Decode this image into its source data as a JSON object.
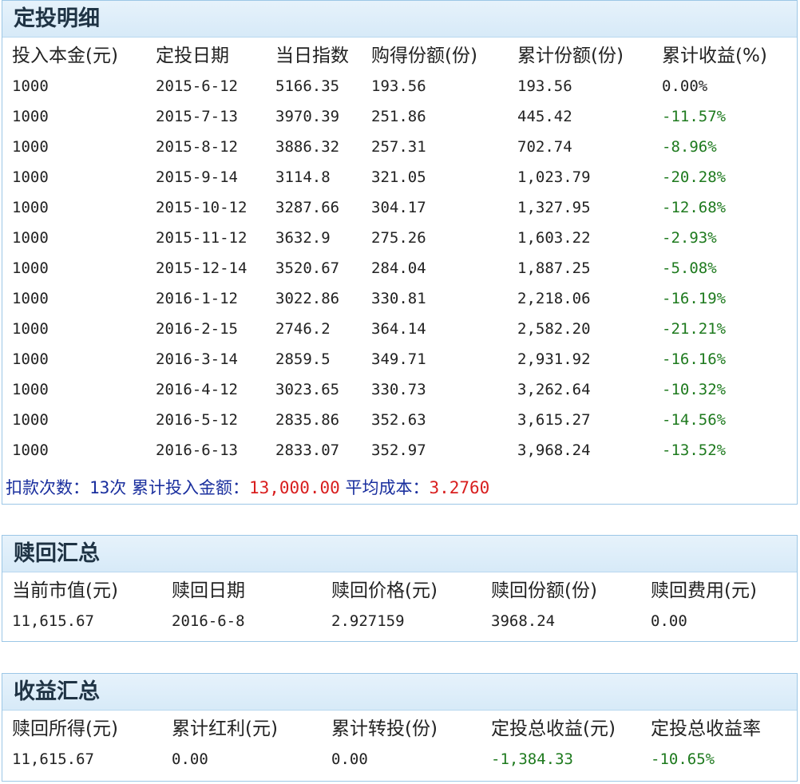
{
  "detail": {
    "title": "定投明细",
    "headers": [
      "投入本金(元)",
      "定投日期",
      "当日指数",
      "购得份额(份)",
      "累计份额(份)",
      "累计收益(%)"
    ],
    "rows": [
      [
        "1000",
        "2015-6-12",
        "5166.35",
        "193.56",
        "193.56",
        "0.00%"
      ],
      [
        "1000",
        "2015-7-13",
        "3970.39",
        "251.86",
        "445.42",
        "-11.57%"
      ],
      [
        "1000",
        "2015-8-12",
        "3886.32",
        "257.31",
        "702.74",
        "-8.96%"
      ],
      [
        "1000",
        "2015-9-14",
        "3114.8",
        "321.05",
        "1,023.79",
        "-20.28%"
      ],
      [
        "1000",
        "2015-10-12",
        "3287.66",
        "304.17",
        "1,327.95",
        "-12.68%"
      ],
      [
        "1000",
        "2015-11-12",
        "3632.9",
        "275.26",
        "1,603.22",
        "-2.93%"
      ],
      [
        "1000",
        "2015-12-14",
        "3520.67",
        "284.04",
        "1,887.25",
        "-5.08%"
      ],
      [
        "1000",
        "2016-1-12",
        "3022.86",
        "330.81",
        "2,218.06",
        "-16.19%"
      ],
      [
        "1000",
        "2016-2-15",
        "2746.2",
        "364.14",
        "2,582.20",
        "-21.21%"
      ],
      [
        "1000",
        "2016-3-14",
        "2859.5",
        "349.71",
        "2,931.92",
        "-16.16%"
      ],
      [
        "1000",
        "2016-4-12",
        "3023.65",
        "330.73",
        "3,262.64",
        "-10.32%"
      ],
      [
        "1000",
        "2016-5-12",
        "2835.86",
        "352.63",
        "3,615.27",
        "-14.56%"
      ],
      [
        "1000",
        "2016-6-13",
        "2833.07",
        "352.97",
        "3,968.24",
        "-13.52%"
      ]
    ],
    "footer": {
      "count_label": "扣款次数：",
      "count_value": "13次",
      "total_label": "累计投入金额：",
      "total_value": "13,000.00",
      "avg_label": "平均成本：",
      "avg_value": "3.2760"
    }
  },
  "redemption": {
    "title": "赎回汇总",
    "headers": [
      "当前市值(元)",
      "赎回日期",
      "赎回价格(元)",
      "赎回份额(份)",
      "赎回费用(元)"
    ],
    "values": [
      "11,615.67",
      "2016-6-8",
      "2.927159",
      "3968.24",
      "0.00"
    ]
  },
  "income": {
    "title": "收益汇总",
    "headers": [
      "赎回所得(元)",
      "累计红利(元)",
      "累计转投(份)",
      "定投总收益(元)",
      "定投总收益率"
    ],
    "values": [
      "11,615.67",
      "0.00",
      "0.00",
      "-1,384.33",
      "-10.65%"
    ]
  },
  "colors": {
    "negative": "#1e7a1e",
    "highlight": "#d81e1e",
    "label_blue": "#1a2f9e",
    "border": "#9cc7e6"
  }
}
